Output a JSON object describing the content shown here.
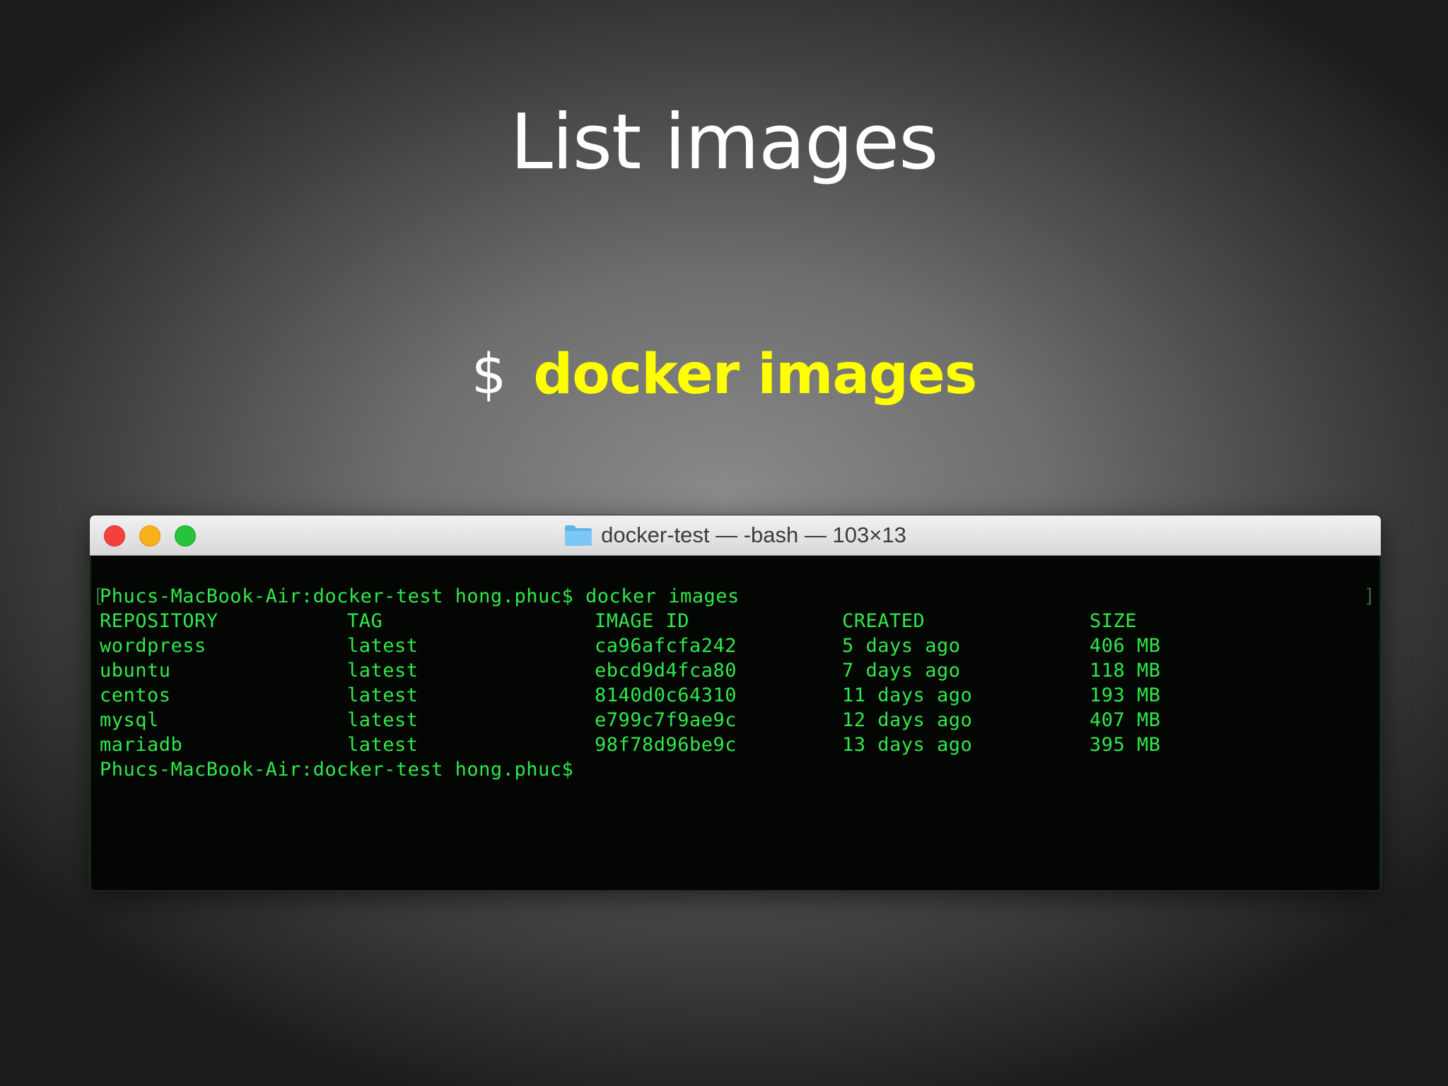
{
  "slide": {
    "title": "List images",
    "prompt_symbol": "$",
    "command": "docker images"
  },
  "terminal": {
    "window_title": "docker-test — -bash — 103×13",
    "title_icon": "folder-icon",
    "bracket_left": "[",
    "bracket_right": "]",
    "command_line": "Phucs-MacBook-Air:docker-test hong.phuc$ docker images",
    "headers": {
      "repository": "REPOSITORY",
      "tag": "TAG",
      "image_id": "IMAGE ID",
      "created": "CREATED",
      "size": "SIZE"
    },
    "rows": [
      {
        "repository": "wordpress",
        "tag": "latest",
        "image_id": "ca96afcfa242",
        "created": "5 days ago",
        "size": "406 MB"
      },
      {
        "repository": "ubuntu",
        "tag": "latest",
        "image_id": "ebcd9d4fca80",
        "created": "7 days ago",
        "size": "118 MB"
      },
      {
        "repository": "centos",
        "tag": "latest",
        "image_id": "8140d0c64310",
        "created": "11 days ago",
        "size": "193 MB"
      },
      {
        "repository": "mysql",
        "tag": "latest",
        "image_id": "e799c7f9ae9c",
        "created": "12 days ago",
        "size": "407 MB"
      },
      {
        "repository": "mariadb",
        "tag": "latest",
        "image_id": "98f78d96be9c",
        "created": "13 days ago",
        "size": "395 MB"
      }
    ],
    "final_prompt": "Phucs-MacBook-Air:docker-test hong.phuc$"
  },
  "colors": {
    "terminal_text": "#2fe84a",
    "command_highlight": "#ffff00",
    "close_button": "#f5413d",
    "minimize_button": "#f8b21c",
    "zoom_button": "#25c43b"
  }
}
